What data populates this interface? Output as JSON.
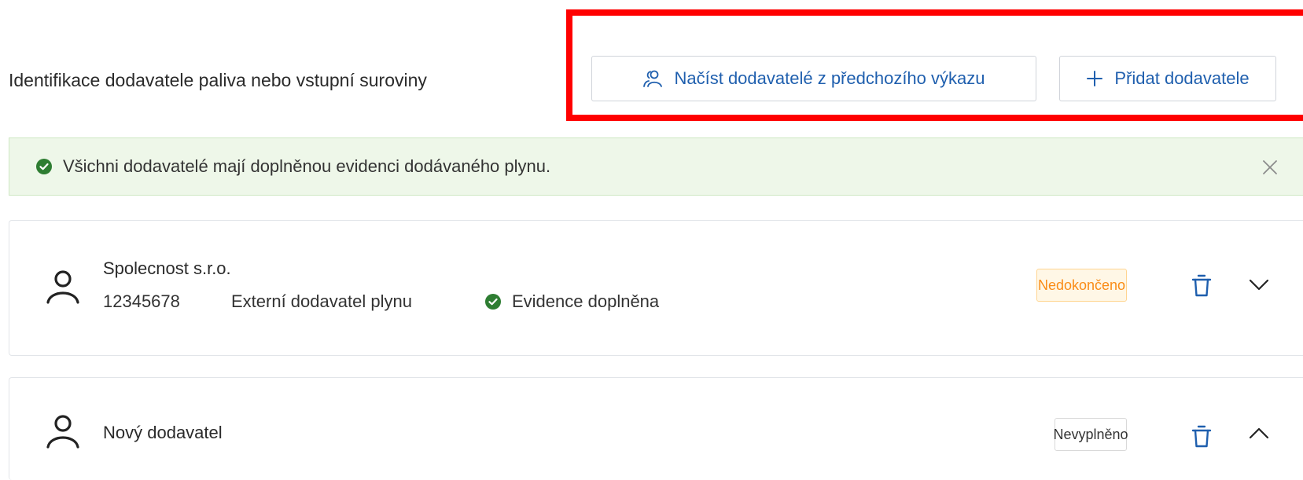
{
  "section": {
    "title": "Identifikace dodavatele paliva nebo vstupní suroviny"
  },
  "actions": {
    "load_label": "Načíst dodavatelé z předchozího výkazu",
    "add_label": "Přidat dodavatele",
    "accent_color": "#1f5fae",
    "highlight_color": "#ff0000"
  },
  "alert": {
    "message": "Všichni dodavatelé mají doplněnou evidenci dodávaného plynu.",
    "icon": "check-circle-icon",
    "background": "#eef7e9"
  },
  "suppliers": [
    {
      "name": "Spolecnost s.r.o.",
      "id": "12345678",
      "type": "Externí dodavatel plynu",
      "evidence": "Evidence doplněna",
      "status": "Nedokončeno",
      "status_color": "#fa8c16",
      "expanded": false
    },
    {
      "name": "Nový dodavatel",
      "status": "Nevyplněno",
      "expanded": true
    }
  ]
}
